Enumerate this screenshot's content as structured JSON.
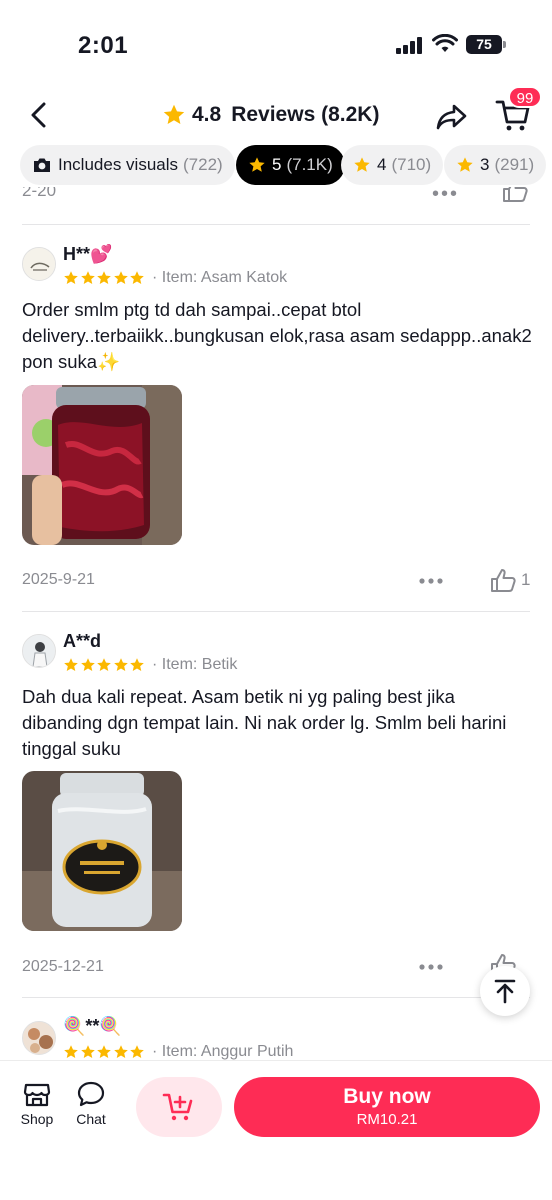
{
  "status_bar": {
    "time": "2:01",
    "battery": "75"
  },
  "header": {
    "rating": "4.8",
    "title": "Reviews (8.2K)",
    "cart_badge": "99"
  },
  "filters": [
    {
      "label": "Includes visuals",
      "count": "(722)",
      "icon": "camera-icon"
    },
    {
      "label": "5",
      "count": "(7.1K)",
      "icon": "star-icon",
      "active": true
    },
    {
      "label": "4",
      "count": "(710)",
      "icon": "star-icon"
    },
    {
      "label": "3",
      "count": "(291)",
      "icon": "star-icon"
    }
  ],
  "previous_review": {
    "date_fragment": "2-20"
  },
  "reviews": [
    {
      "username": "H**💕",
      "stars": 5,
      "item": "· Item: Asam Katok",
      "text": "Order smlm ptg td dah sampai..cepat btol delivery..terbaiikk..bungkusan elok,rasa asam sedappp..anak2 pon suka✨",
      "date": "2025-9-21",
      "likes": "1"
    },
    {
      "username": "A**d",
      "stars": 5,
      "item": "· Item: Betik",
      "text": "Dah dua kali repeat. Asam betik ni yg paling best jika dibanding dgn tempat lain. Ni nak order lg. Smlm beli harini tinggal suku",
      "date": "2025-12-21",
      "likes": ""
    },
    {
      "username": "🍭**🍭",
      "stars": 5,
      "item": "· Item: Anggur Putih"
    }
  ],
  "bottom_bar": {
    "shop_label": "Shop",
    "chat_label": "Chat",
    "buy_label": "Buy now",
    "buy_price": "RM10.21"
  },
  "colors": {
    "accent": "#fe2c55",
    "star": "#fbb800",
    "muted": "#8a8b91"
  }
}
